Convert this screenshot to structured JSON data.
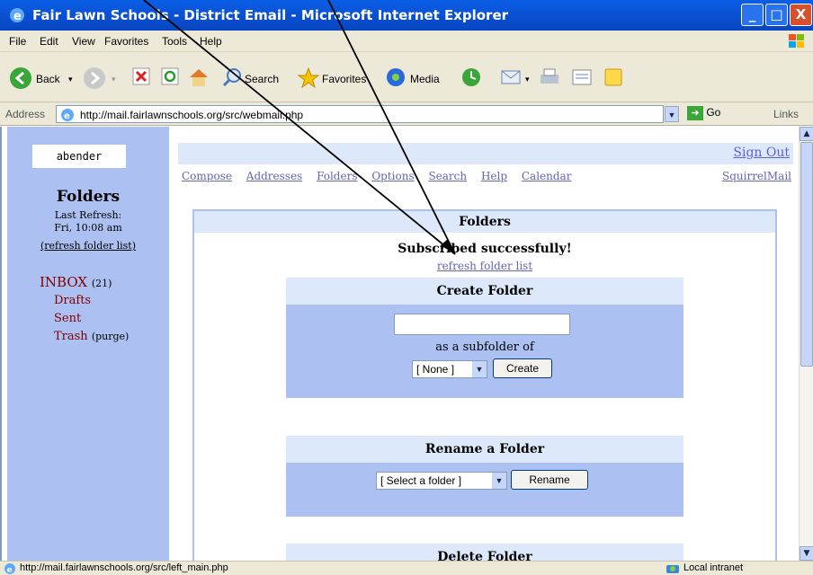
{
  "window": {
    "title": "Fair Lawn Schools - District Email - Microsoft Internet Explorer",
    "controls": {
      "minimize": "_",
      "maximize": "□",
      "close": "X"
    }
  },
  "menu": [
    "File",
    "Edit",
    "View",
    "Favorites",
    "Tools",
    "Help"
  ],
  "toolbar": {
    "back": "Back",
    "search": "Search",
    "favorites": "Favorites",
    "media": "Media"
  },
  "address": {
    "label": "Address",
    "url": "http://mail.fairlawnschools.org/src/webmail.php",
    "go": "Go",
    "links": "Links"
  },
  "left": {
    "username": "abender",
    "folders_heading": "Folders",
    "last_refresh_label": "Last Refresh:",
    "last_refresh_time": "Fri, 10:08 am",
    "refresh_link": "(refresh folder list)",
    "inbox_label": "INBOX",
    "inbox_count": "(21)",
    "drafts": "Drafts",
    "sent": "Sent",
    "trash": "Trash",
    "purge": "(purge)"
  },
  "top": {
    "sign_out": "Sign Out",
    "nav": [
      "Compose",
      "Addresses",
      "Folders",
      "Options",
      "Search",
      "Help",
      "Calendar"
    ],
    "squirrelmail": "SquirrelMail"
  },
  "folders_page": {
    "heading": "Folders",
    "message": "Subscribed successfully!",
    "refresh_link": "refresh folder list",
    "create": {
      "heading": "Create Folder",
      "input_value": "",
      "subfolder_label": "as a subfolder of",
      "parent_selected": "[ None ]",
      "button": "Create"
    },
    "rename": {
      "heading": "Rename a Folder",
      "selected": "[ Select a folder ]",
      "button": "Rename"
    },
    "delete": {
      "heading": "Delete Folder"
    }
  },
  "status": {
    "text": "http://mail.fairlawnschools.org/src/left_main.php",
    "zone": "Local intranet"
  }
}
